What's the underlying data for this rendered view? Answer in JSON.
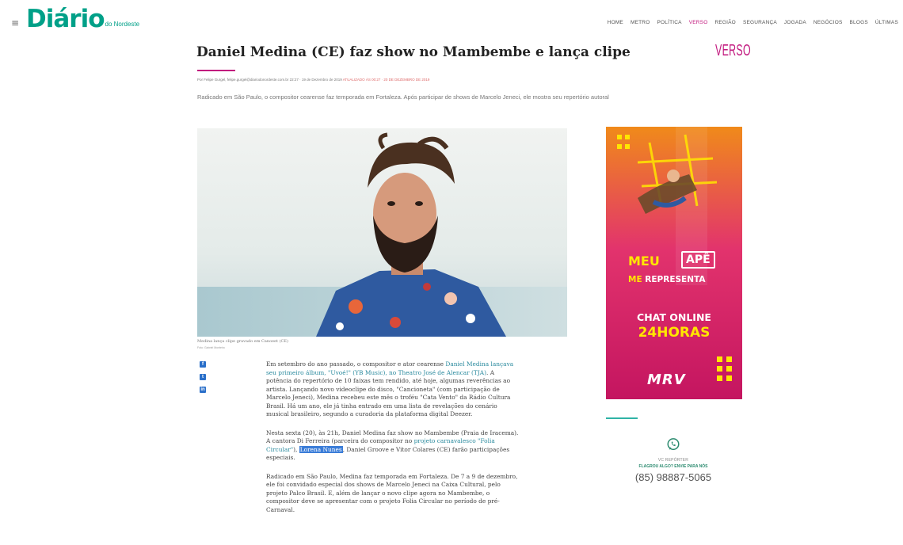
{
  "header": {
    "menu_icon": "≡",
    "logo_main": "Diário",
    "logo_sub": "do Nordeste",
    "nav": [
      "HOME",
      "METRO",
      "POLÍTICA",
      "VERSO",
      "REGIÃO",
      "SEGURANÇA",
      "JOGADA",
      "NEGÓCIOS",
      "BLOGS",
      "ÚLTIMAS"
    ],
    "nav_active": "VERSO"
  },
  "article": {
    "title": "Daniel Medina (CE) faz show no Mambembe e lança clipe",
    "section": "VERSO",
    "byline": "Por Felipe Gurgel, felipe.gurgel@diariodonordeste.com.br",
    "published": "22:27 · 19 de Dezembro de 2019",
    "updated": "ATUALIZADO ÀS 00:27 · 20 DE DEZEMBRO DE 2019",
    "subtitle": "Radicado em São Paulo, o compositor cearense faz temporada em Fortaleza. Após participar de shows de Marcelo Jeneci, ele mostra seu repertório autoral",
    "photo_caption": "Medina lança clipe gravado em Canoeet (CE)",
    "photo_credit": "Foto: Gabriel Monteiro",
    "share": [
      "f",
      "t",
      "in"
    ],
    "p1_a": "Em setembro do ano passado, o compositor e ator cearense ",
    "p1_link": "Daniel Medina lançava seu primeiro álbum, \"Uvoé!\" (YB Music), no Theatro José de Alencar (TJA)",
    "p1_b": ". A potência do repertório de 10 faixas tem rendido, até hoje, algumas reverências ao artista. Lançando novo videoclipe do disco, \"Cancioneta\" (com participação de Marcelo Jeneci), Medina recebeu este mês o troféu \"Cata Vento\" da Rádio Cultura Brasil. Há um ano, ele já tinha entrado em uma lista de revelações do cenário musical brasileiro, segundo a curadoria da plataforma digital Deezer.",
    "p2_a": "Nesta sexta (20), às 21h, Daniel Medina faz show no Mambembe (Praia de Iracema). A cantora Di Ferreira (parceira do compositor no ",
    "p2_link": "projeto carnavalesco \"Folia Circular\"",
    "p2_b": "), ",
    "p2_hl": "Lorena Nunes",
    "p2_c": ", Daniel Groove e Vitor Colares (CE) farão participações especiais.",
    "p3": "Radicado em São Paulo, Medina faz temporada em Fortaleza. De 7 a 9 de dezembro, ele foi convidado especial dos shows de Marcelo Jeneci na Caixa Cultural, pelo projeto Palco Brasil. E, além de lançar o novo clipe agora no Mambembe, o compositor deve se apresentar com o projeto Folia Circular no período de pré-Carnaval."
  },
  "ad": {
    "meu": "MEU",
    "ape": "APÊ",
    "me": "ME",
    "representa": "REPRESENTA",
    "chat": "CHAT ONLINE",
    "hours": "24HORAS",
    "brand": "MRV",
    "colors": {
      "top": "#f08a1a",
      "mid": "#e2336d",
      "bottom": "#c41560",
      "accent": "#ffe600"
    }
  },
  "reporter": {
    "icon": "whatsapp-icon",
    "label": "VC REPÓRTER",
    "cta": "FLAGROU ALGO? ENVIE PARA NÓS",
    "phone": "(85) 98887-5065"
  },
  "colors": {
    "brand": "#00a088",
    "section": "#c2187e",
    "link": "#2a8a9e"
  }
}
